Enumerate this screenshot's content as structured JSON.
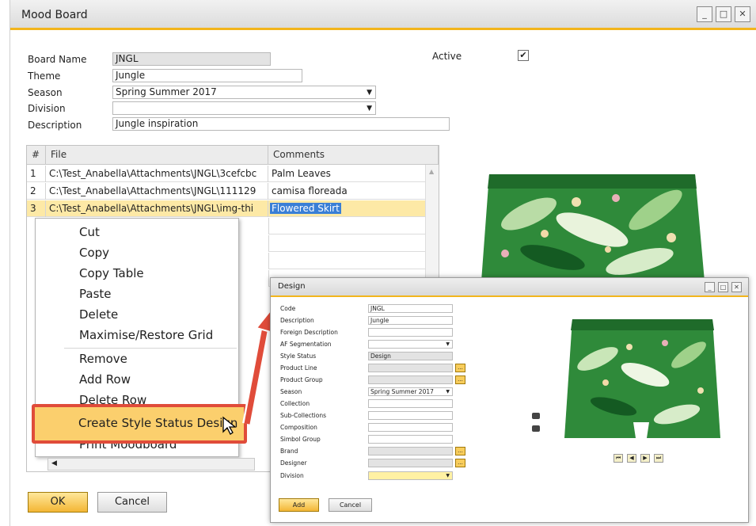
{
  "main_window": {
    "title": "Mood Board",
    "controls": [
      "_",
      "□",
      "✕"
    ],
    "fields": {
      "board_name": {
        "label": "Board Name",
        "value": "JNGL"
      },
      "theme": {
        "label": "Theme",
        "value": "Jungle"
      },
      "season": {
        "label": "Season",
        "value": "Spring Summer 2017"
      },
      "division": {
        "label": "Division",
        "value": ""
      },
      "description": {
        "label": "Description",
        "value": "Jungle inspiration"
      },
      "active": {
        "label": "Active",
        "checked": true,
        "mark": "✔"
      }
    },
    "grid": {
      "columns": [
        "#",
        "File",
        "Comments"
      ],
      "rows": [
        {
          "n": "1",
          "file": "C:\\Test_Anabella\\Attachments\\JNGL\\3cefcbc",
          "comment": "Palm Leaves"
        },
        {
          "n": "2",
          "file": "C:\\Test_Anabella\\Attachments\\JNGL\\111129",
          "comment": "camisa floreada"
        },
        {
          "n": "3",
          "file": "C:\\Test_Anabella\\Attachments\\JNGL\\img-thi",
          "comment": "Flowered Skirt"
        }
      ]
    },
    "buttons": {
      "ok": "OK",
      "cancel": "Cancel"
    }
  },
  "context_menu": {
    "items": [
      "Cut",
      "Copy",
      "Copy Table",
      "Paste",
      "Delete",
      "Maximise/Restore Grid",
      "Remove",
      "Add Row",
      "Delete Row",
      "Create Style Status Design",
      "Print Moodboard"
    ],
    "highlighted": "Create Style Status Design"
  },
  "design_window": {
    "title": "Design",
    "fields": [
      {
        "label": "Code",
        "value": "JNGL",
        "style": "white"
      },
      {
        "label": "Description",
        "value": "Jungle",
        "style": "white"
      },
      {
        "label": "Foreign Description",
        "value": "",
        "style": "white"
      },
      {
        "label": "AF Segmentation",
        "value": "",
        "style": "white",
        "dropdown": true
      },
      {
        "label": "Style Status",
        "value": "Design",
        "style": "gray"
      },
      {
        "label": "Product Line",
        "value": "",
        "style": "gray",
        "more": true
      },
      {
        "label": "Product Group",
        "value": "",
        "style": "gray",
        "more": true
      },
      {
        "label": "Season",
        "value": "Spring Summer 2017",
        "style": "white",
        "dropdown": true
      },
      {
        "label": "Collection",
        "value": "",
        "style": "white"
      },
      {
        "label": "Sub-Collections",
        "value": "",
        "style": "white"
      },
      {
        "label": "Composition",
        "value": "",
        "style": "white"
      },
      {
        "label": "Simbol Group",
        "value": "",
        "style": "white"
      },
      {
        "label": "Brand",
        "value": "",
        "style": "gray",
        "more": true
      },
      {
        "label": "Designer",
        "value": "",
        "style": "gray",
        "more": true
      },
      {
        "label": "Division",
        "value": "",
        "style": "yellow",
        "dropdown": true
      }
    ],
    "more_label": "...",
    "nav": [
      "⏮",
      "◀",
      "▶",
      "⏭"
    ],
    "buttons": {
      "add": "Add",
      "cancel": "Cancel"
    }
  },
  "colors": {
    "accent": "#f2b51d",
    "highlight_border": "#e04c3a",
    "selected_row": "#fde9a6"
  }
}
